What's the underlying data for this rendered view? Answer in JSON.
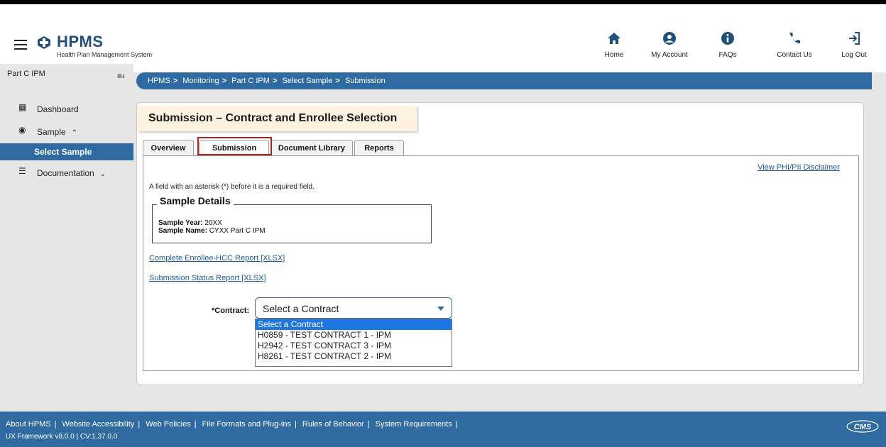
{
  "header": {
    "logo_title": "HPMS",
    "logo_subtitle": "Health Plan Management System",
    "nav": [
      {
        "label": "Home",
        "icon": "home-icon"
      },
      {
        "label": "My Account",
        "icon": "account-icon"
      },
      {
        "label": "FAQs",
        "icon": "info-icon"
      },
      {
        "label": "Contact Us",
        "icon": "phone-icon"
      },
      {
        "label": "Log Out",
        "icon": "logout-icon"
      }
    ]
  },
  "sidebar": {
    "title": "Part C IPM",
    "items": [
      {
        "label": "Dashboard",
        "icon": "grid-icon"
      },
      {
        "label": "Sample",
        "icon": "radio-target-icon",
        "expanded": true
      },
      {
        "label": "Select Sample",
        "selected": true
      },
      {
        "label": "Documentation",
        "icon": "list-icon",
        "expanded": false
      }
    ]
  },
  "breadcrumb": [
    "HPMS",
    "Monitoring",
    "Part C IPM",
    "Select Sample",
    "Submission"
  ],
  "panel": {
    "title": "Submission – Contract and Enrollee Selection",
    "tabs": [
      {
        "label": "Overview",
        "active": false
      },
      {
        "label": "Submission",
        "active": true
      },
      {
        "label": "Document Library",
        "active": false
      },
      {
        "label": "Reports",
        "active": false
      }
    ],
    "disclaimer_link": "View PHI/PII Disclaimer",
    "required_note": "A field with an asterisk (*) before it is a required field.",
    "sample_details": {
      "legend": "Sample Details",
      "year_label": "Sample Year:",
      "year_value": "20XX",
      "name_label": "Sample Name:",
      "name_value": "CYXX Part C IPM"
    },
    "links": [
      "Complete Enrollee-HCC Report [XLSX]",
      "Submission Status Report [XLSX]"
    ],
    "contract": {
      "label": "*Contract:",
      "selected": "Select a Contract",
      "options": [
        "Select a Contract",
        "H0859 - TEST CONTRACT 1 - IPM",
        "H2942 - TEST CONTRACT 3 - IPM",
        "H8261 - TEST CONTRACT 2 - IPM"
      ]
    }
  },
  "footer": {
    "links": [
      "About HPMS",
      "Website Accessibility",
      "Web Policies",
      "File Formats and Plug-ins",
      "Rules of Behavior",
      "System Requirements"
    ],
    "version": "UX Framework v8.0.0 | CV:1.37.0.0",
    "logo_text": "CMS"
  },
  "colors": {
    "primary": "#2f6aa1",
    "title_bg": "#fdf3e0",
    "highlight": "#b22222",
    "link": "#1a5aa0"
  }
}
